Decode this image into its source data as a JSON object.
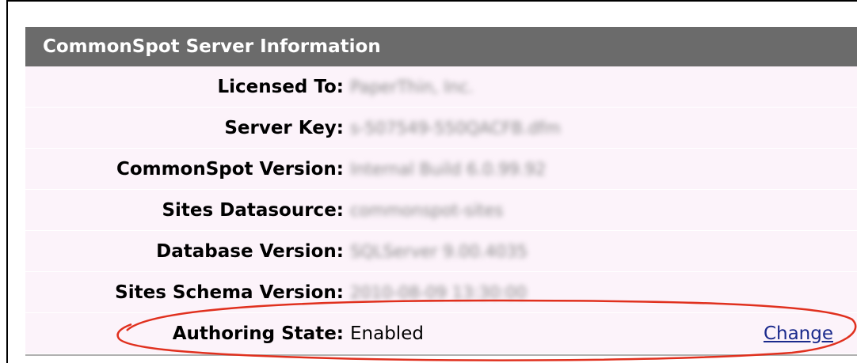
{
  "panel": {
    "title": "CommonSpot Server Information",
    "rows": [
      {
        "label": "Licensed To:",
        "value": "PaperThin, Inc."
      },
      {
        "label": "Server Key:",
        "value": "s-507549-550QACFB.dfm"
      },
      {
        "label": "CommonSpot Version:",
        "value": "Internal Build 6.0.99.92"
      },
      {
        "label": "Sites Datasource:",
        "value": "commonspot-sites"
      },
      {
        "label": "Database Version:",
        "value": "SQLServer 9.00.4035"
      },
      {
        "label": "Sites Schema Version:",
        "value": "2010-08-09 13:30:00"
      }
    ],
    "authoring": {
      "label": "Authoring State:",
      "value": "Enabled",
      "action": "Change"
    }
  },
  "annotation": {
    "color": "#e0301e"
  }
}
